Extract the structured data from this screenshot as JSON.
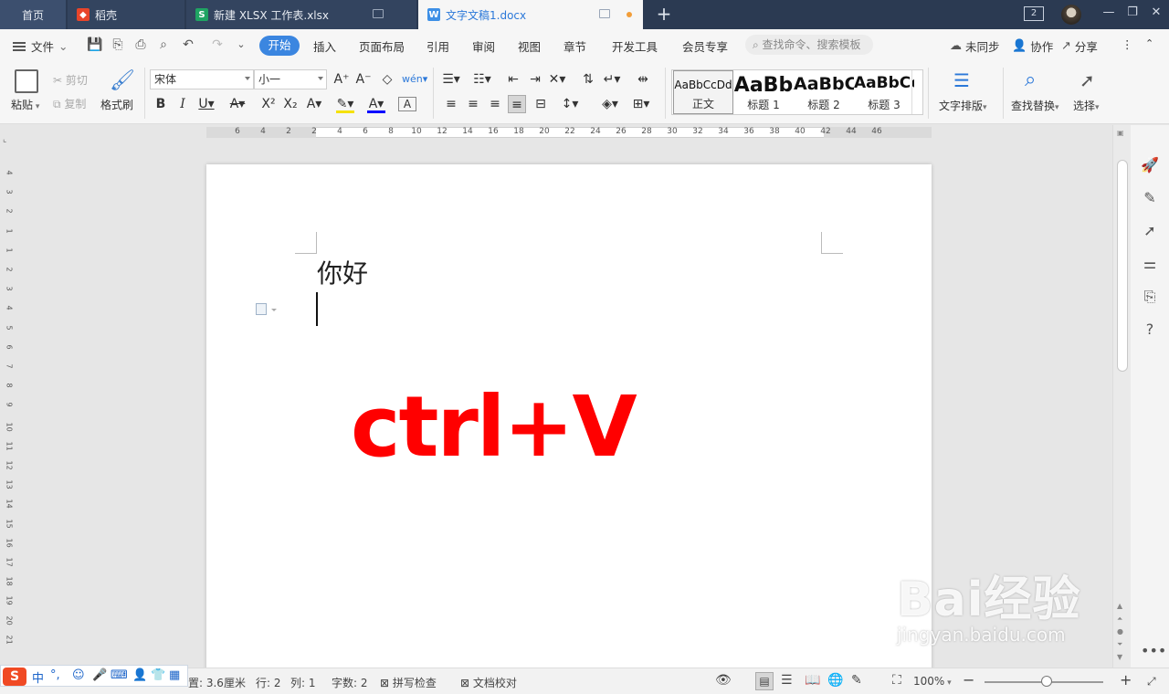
{
  "tabs": {
    "home": "首页",
    "daoke": "稻壳",
    "xlsx": "新建 XLSX 工作表.xlsx",
    "docx": "文字文稿1.docx",
    "window_count": "2"
  },
  "menu": {
    "file": "文件",
    "start": "开始",
    "insert": "插入",
    "layout": "页面布局",
    "reference": "引用",
    "review": "审阅",
    "view": "视图",
    "chapter": "章节",
    "devtools": "开发工具",
    "member": "会员专享",
    "search_placeholder": "查找命令、搜索模板",
    "sync": "未同步",
    "collab": "协作",
    "share": "分享"
  },
  "ribbon": {
    "paste": "粘贴",
    "cut": "剪切",
    "copy": "复制",
    "format_painter": "格式刷",
    "font_name": "宋体",
    "font_size": "小一",
    "styles": [
      {
        "preview": "AaBbCcDd",
        "label": "正文"
      },
      {
        "preview": "AaBb",
        "label": "标题 1"
      },
      {
        "preview": "AaBbC",
        "label": "标题 2"
      },
      {
        "preview": "AaBbCc",
        "label": "标题 3"
      }
    ],
    "text_layout": "文字排版",
    "find_replace": "查找替换",
    "select": "选择"
  },
  "ruler": {
    "h_numbers": [
      "6",
      "4",
      "2",
      "2",
      "4",
      "6",
      "8",
      "10",
      "12",
      "14",
      "16",
      "18",
      "20",
      "22",
      "24",
      "26",
      "28",
      "30",
      "32",
      "34",
      "36",
      "38",
      "40",
      "42",
      "44",
      "46"
    ],
    "v_numbers": [
      "4",
      "3",
      "2",
      "1",
      "1",
      "2",
      "3",
      "4",
      "5",
      "6",
      "7",
      "8",
      "9",
      "10",
      "11",
      "12",
      "13",
      "14",
      "15",
      "16",
      "17",
      "18",
      "19",
      "20",
      "21"
    ]
  },
  "document": {
    "text": "你好",
    "overlay": "ctrl+V"
  },
  "watermark": {
    "logo": "Bai经验",
    "url": "jingyan.baidu.com"
  },
  "status": {
    "position": "置: 3.6厘米",
    "line": "行: 2",
    "column": "列: 1",
    "word_count": "字数: 2",
    "spell_check": "拼写检查",
    "doc_proof": "文档校对",
    "zoom": "100%"
  },
  "ime": {
    "lang": "中",
    "punct": "°,"
  },
  "colors": {
    "accent": "#3b86e0",
    "title_bar": "#2b3a52",
    "overlay": "#ff0000"
  }
}
